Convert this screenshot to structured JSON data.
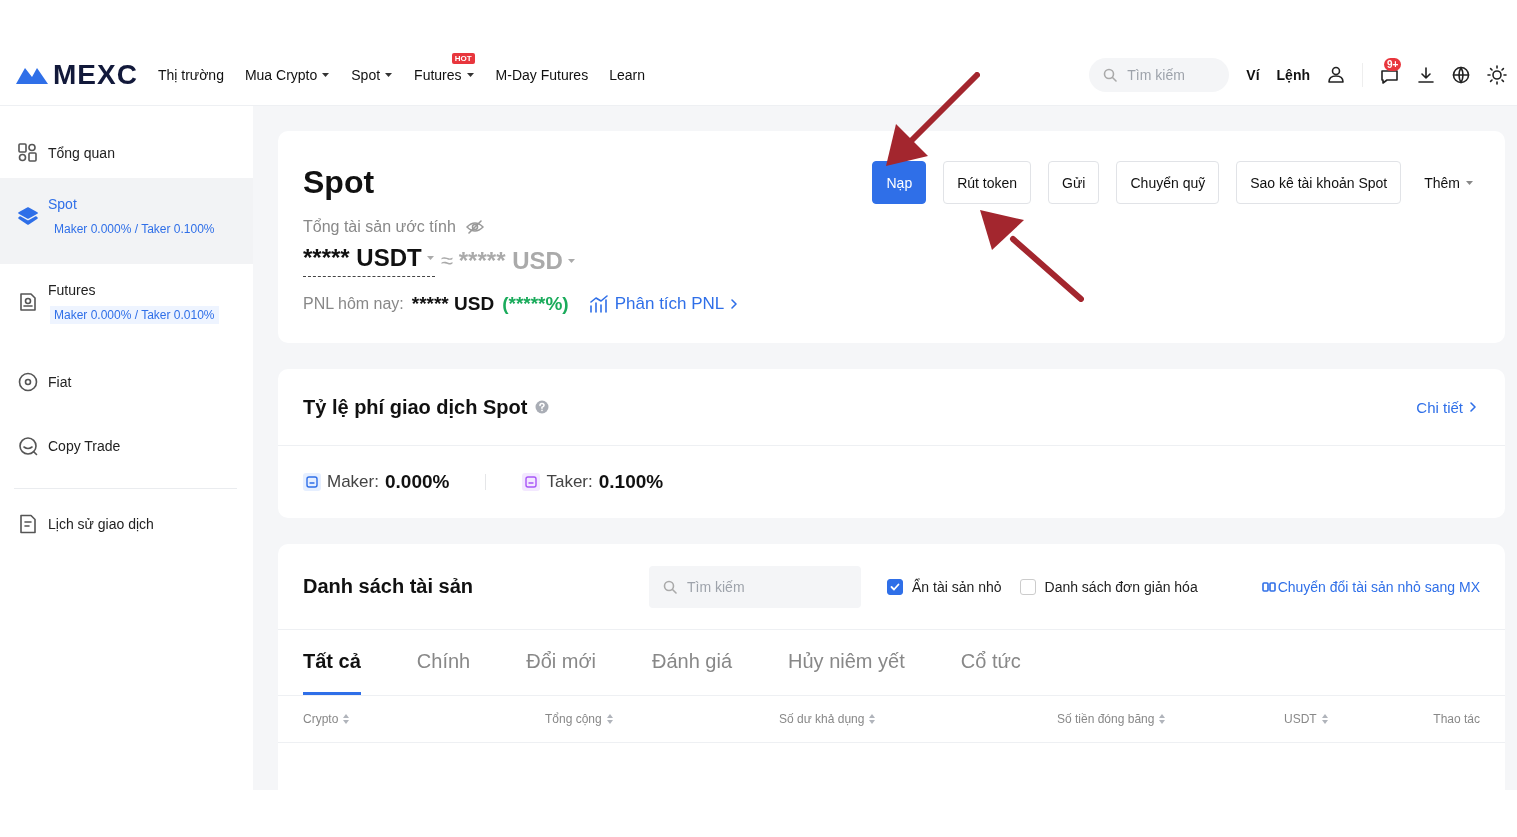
{
  "header": {
    "logo": "MEXC",
    "nav": [
      {
        "label": "Thị trường",
        "dropdown": false
      },
      {
        "label": "Mua Crypto",
        "dropdown": true
      },
      {
        "label": "Spot",
        "dropdown": true
      },
      {
        "label": "Futures",
        "dropdown": true,
        "badge": "HOT"
      },
      {
        "label": "M-Day Futures",
        "dropdown": false
      },
      {
        "label": "Learn",
        "dropdown": false
      }
    ],
    "search": {
      "placeholder": "Tìm kiếm"
    },
    "links": [
      "Ví",
      "Lệnh"
    ],
    "notification_badge": "9+"
  },
  "sidebar": {
    "items": [
      {
        "label": "Tổng quan",
        "selected": false
      },
      {
        "label": "Spot",
        "fee": "Maker 0.000% / Taker 0.100%",
        "selected": true
      },
      {
        "label": "Futures",
        "fee": "Maker 0.000% / Taker 0.010%",
        "selected": false
      },
      {
        "label": "Fiat",
        "selected": false
      },
      {
        "label": "Copy Trade",
        "selected": false
      },
      {
        "label": "Lịch sử giao dịch",
        "selected": false
      }
    ]
  },
  "overview": {
    "title": "Spot",
    "buttons": [
      {
        "label": "Nạp",
        "primary": true
      },
      {
        "label": "Rút token",
        "primary": false
      },
      {
        "label": "Gửi",
        "primary": false
      },
      {
        "label": "Chuyển quỹ",
        "primary": false
      },
      {
        "label": "Sao kê tài khoản Spot",
        "primary": false
      }
    ],
    "more": "Thêm",
    "estimate_label": "Tổng tài sản ước tính",
    "balance": "***** USDT",
    "approx": "≈",
    "balance_usd": "***** USD",
    "pnl_label": "PNL hôm nay:",
    "pnl_value": "***** USD",
    "pnl_percent": "(*****%)",
    "pnl_link": "Phân tích PNL"
  },
  "fees": {
    "title": "Tỷ lệ phí giao dịch Spot",
    "detail_link": "Chi tiết",
    "items": [
      {
        "label": "Maker:",
        "value": "0.000%"
      },
      {
        "label": "Taker:",
        "value": "0.100%"
      }
    ]
  },
  "assets": {
    "title": "Danh sách tài sản",
    "search": {
      "placeholder": "Tìm kiếm"
    },
    "checkboxes": [
      {
        "label": "Ẩn tài sản nhỏ",
        "checked": true
      },
      {
        "label": "Danh sách đơn giản hóa",
        "checked": false
      }
    ],
    "convert_link": "Chuyển đổi tài sản nhỏ sang MX",
    "tabs": [
      {
        "label": "Tất cả",
        "selected": true
      },
      {
        "label": "Chính",
        "selected": false
      },
      {
        "label": "Đổi mới",
        "selected": false
      },
      {
        "label": "Đánh giá",
        "selected": false
      },
      {
        "label": "Hủy niêm yết",
        "selected": false
      },
      {
        "label": "Cổ tức",
        "selected": false
      }
    ],
    "columns": [
      {
        "label": "Crypto",
        "sortable": true
      },
      {
        "label": "Tổng cộng",
        "sortable": true
      },
      {
        "label": "Số dư khả dụng",
        "sortable": true
      },
      {
        "label": "Số tiền đóng băng",
        "sortable": true
      },
      {
        "label": "USDT",
        "sortable": true
      },
      {
        "label": "Thao tác",
        "sortable": false
      }
    ]
  }
}
